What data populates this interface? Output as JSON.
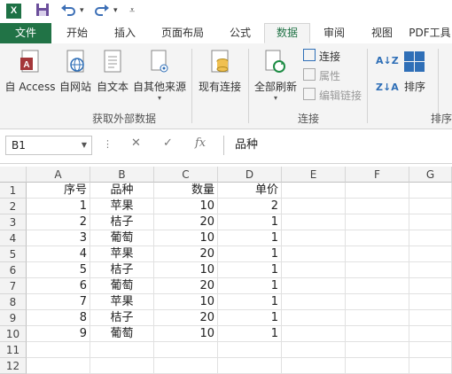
{
  "quick_access": {
    "logo": "X",
    "save_icon": "save-icon",
    "undo_icon": "undo-icon",
    "redo_icon": "redo-icon"
  },
  "tabs": [
    "文件",
    "开始",
    "插入",
    "页面布局",
    "公式",
    "数据",
    "审阅",
    "视图",
    "PDF工具"
  ],
  "active_tab": "数据",
  "ribbon": {
    "from_access": "自 Access",
    "from_web": "自网站",
    "from_text": "自文本",
    "from_other": "自其他来源",
    "existing_conn": "现有连接",
    "refresh_all": "全部刷新",
    "connections": "连接",
    "properties": "属性",
    "edit_links": "编辑链接",
    "sort": "排序",
    "group_get_external": "获取外部数据",
    "group_connections": "连接",
    "group_sort": "排序"
  },
  "formula_bar": {
    "name_box": "B1",
    "fx": "fx",
    "value": "品种"
  },
  "columns": [
    "A",
    "B",
    "C",
    "D",
    "E",
    "F",
    "G"
  ],
  "rows": [
    {
      "n": "1",
      "a": "序号",
      "b": "品种",
      "c": "数量",
      "d": "单价"
    },
    {
      "n": "2",
      "a": "1",
      "b": "苹果",
      "c": "10",
      "d": "2"
    },
    {
      "n": "3",
      "a": "2",
      "b": "桔子",
      "c": "20",
      "d": "1"
    },
    {
      "n": "4",
      "a": "3",
      "b": "葡萄",
      "c": "10",
      "d": "1"
    },
    {
      "n": "5",
      "a": "4",
      "b": "苹果",
      "c": "20",
      "d": "1"
    },
    {
      "n": "6",
      "a": "5",
      "b": "桔子",
      "c": "10",
      "d": "1"
    },
    {
      "n": "7",
      "a": "6",
      "b": "葡萄",
      "c": "20",
      "d": "1"
    },
    {
      "n": "8",
      "a": "7",
      "b": "苹果",
      "c": "10",
      "d": "1"
    },
    {
      "n": "9",
      "a": "8",
      "b": "桔子",
      "c": "20",
      "d": "1"
    },
    {
      "n": "10",
      "a": "9",
      "b": "葡萄",
      "c": "10",
      "d": "1"
    },
    {
      "n": "11",
      "a": "",
      "b": "",
      "c": "",
      "d": ""
    },
    {
      "n": "12",
      "a": "",
      "b": "",
      "c": "",
      "d": ""
    }
  ]
}
